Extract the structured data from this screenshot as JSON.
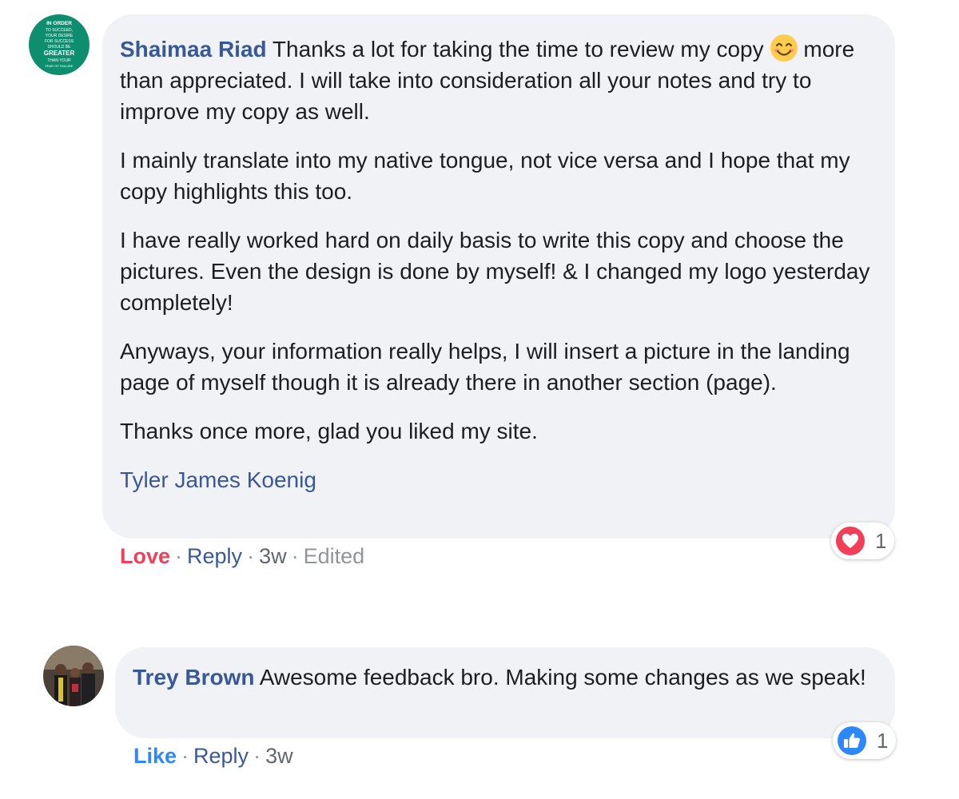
{
  "comments": [
    {
      "author": "Shaimaa Riad",
      "avatar_text": [
        "IN ORDER",
        "TO SUCCEED,",
        "YOUR DESIRE",
        "FOR SUCCESS",
        "SHOULD BE",
        "GREATER",
        "THAN YOUR",
        "FEAR OF FAILURE"
      ],
      "avatar_color": "#0d8f6f",
      "paragraphs": [
        "Thanks a lot for taking the time to review my copy",
        "more than appreciated. I will take into consideration all your notes and try to improve my copy as well.",
        "I mainly translate into my native tongue, not vice versa and I hope that my copy highlights this too.",
        "I have really worked hard on daily basis to write this copy and choose the pictures. Even the design is done by myself! & I changed my logo yesterday completely!",
        "Anyways, your information really helps, I will insert a picture in the landing page of myself though it is already there in another section (page).",
        "Thanks once more, glad you liked my site."
      ],
      "emoji": "smiling-face-icon",
      "mention": "Tyler James Koenig",
      "reaction_label": "Love",
      "reply_label": "Reply",
      "time": "3w",
      "edited": "Edited",
      "reaction_icon": "heart-icon",
      "reaction_count": "1",
      "reaction_color": "#f33e58"
    },
    {
      "author": "Trey Brown",
      "paragraphs": [
        "Awesome feedback bro. Making some changes as we speak!"
      ],
      "reaction_label": "Like",
      "reply_label": "Reply",
      "time": "3w",
      "reaction_icon": "thumbs-up-icon",
      "reaction_count": "1",
      "reaction_color": "#2d88ff"
    }
  ]
}
